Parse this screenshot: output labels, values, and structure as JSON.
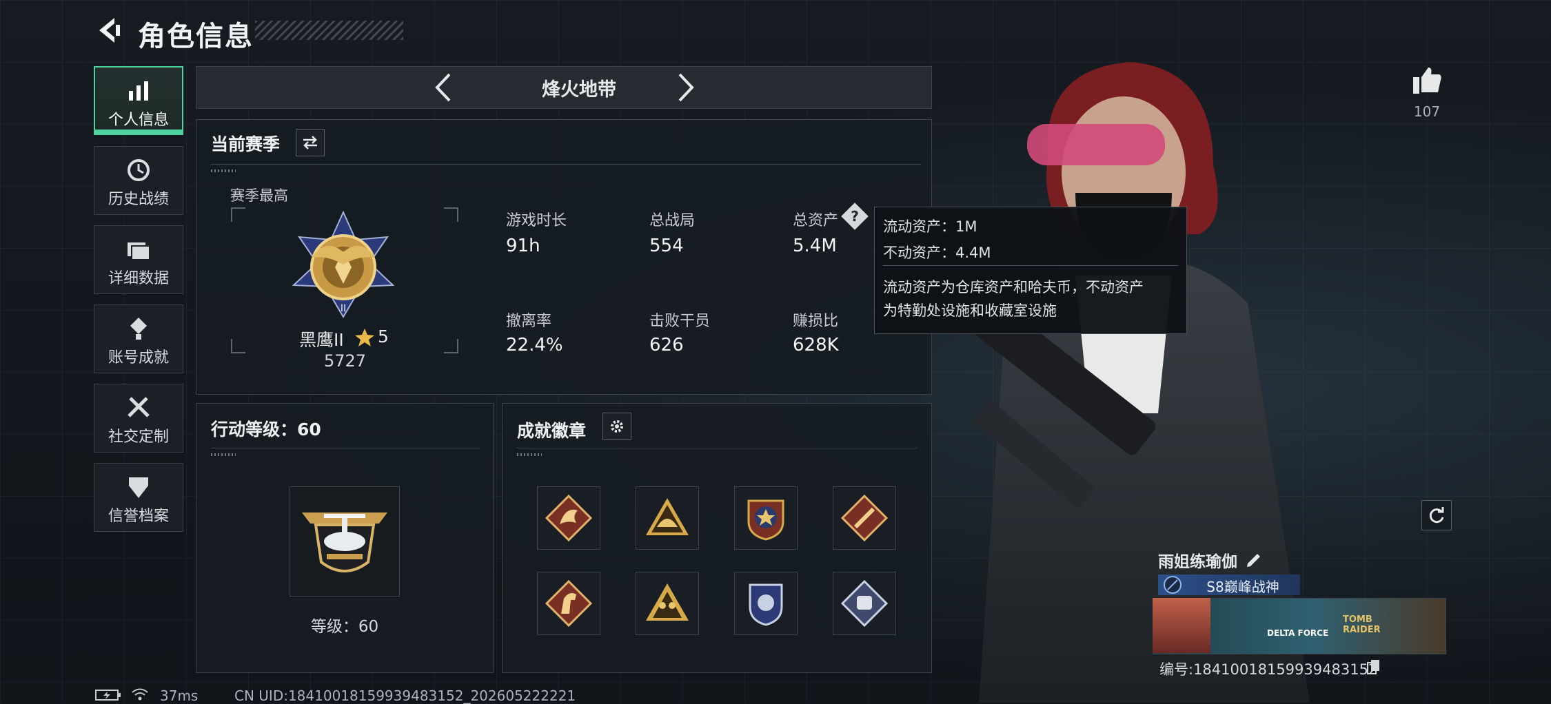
{
  "header": {
    "title": "角色信息"
  },
  "sidebar": {
    "items": [
      {
        "label": "个人信息",
        "icon": "bar-chart-icon"
      },
      {
        "label": "历史战绩",
        "icon": "history-icon"
      },
      {
        "label": "详细数据",
        "icon": "folders-icon"
      },
      {
        "label": "账号成就",
        "icon": "medal-icon"
      },
      {
        "label": "社交定制",
        "icon": "tools-icon"
      },
      {
        "label": "信誉档案",
        "icon": "shield-icon"
      }
    ],
    "active_index": 0
  },
  "mode_selector": {
    "label": "烽火地带"
  },
  "season": {
    "title": "当前赛季",
    "best_label": "赛季最高",
    "rank_name": "黑鹰II",
    "rank_stars": "5",
    "rank_score": "5727",
    "stats": [
      {
        "label": "游戏时长",
        "value": "91h"
      },
      {
        "label": "总战局",
        "value": "554"
      },
      {
        "label": "总资产",
        "value": "5.4M"
      },
      {
        "label": "撤离率",
        "value": "22.4%"
      },
      {
        "label": "击败干员",
        "value": "626"
      },
      {
        "label": "赚损比",
        "value": "628K"
      }
    ]
  },
  "tooltip": {
    "line1": "流动资产：1M",
    "line2": "不动资产：4.4M",
    "desc1": "流动资产为仓库资产和哈夫币，不动资产",
    "desc2": "为特勤处设施和收藏室设施"
  },
  "action_level": {
    "title": "行动等级：60",
    "level_text": "等级：60"
  },
  "achievements": {
    "title": "成就徽章",
    "badges": [
      "dragon-badge-icon",
      "helmet-badge-icon",
      "star-emblem-badge-icon",
      "wrench-badge-icon",
      "horse-badge-icon",
      "soldiers-badge-icon",
      "police-badge-icon",
      "fist-badge-icon"
    ]
  },
  "profile": {
    "likes": "107",
    "name": "雨姐练瑜伽",
    "title_badge": "S8巅峰战神",
    "id_text": "编号:18410018159939483152",
    "banner_text1": "DELTA FORCE",
    "banner_text2": "TOMB RAIDER"
  },
  "footer": {
    "ping": "37ms",
    "uid": "CN UID:18410018159939483152_202605222221"
  },
  "colors": {
    "accent": "#4fd1a0",
    "gold": "#d3a64a",
    "tooltip_bg": "#0e1216"
  }
}
